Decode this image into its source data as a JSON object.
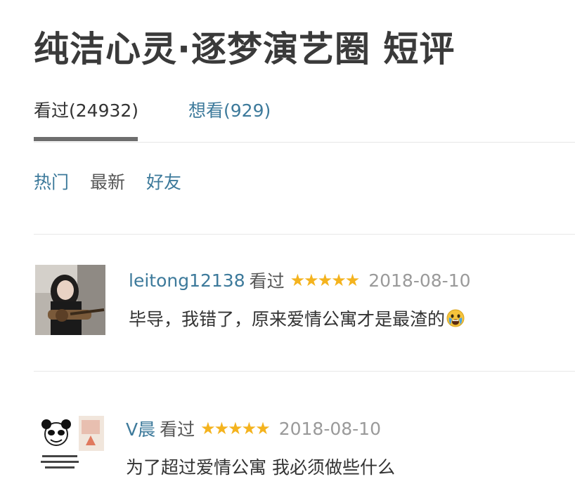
{
  "page": {
    "title": "纯洁心灵·逐梦演艺圈 短评"
  },
  "tabs": [
    {
      "label": "看过(24932)",
      "active": true
    },
    {
      "label": "想看(929)",
      "active": false
    }
  ],
  "filters": [
    {
      "label": "热门"
    },
    {
      "label": "最新"
    },
    {
      "label": "好友"
    }
  ],
  "comments": [
    {
      "username": "leitong12138",
      "status": "看过",
      "rating_stars": 5,
      "date": "2018-08-10",
      "text": "毕导，我错了，原来爱情公寓才是最渣的",
      "emoji": "crying-face-icon"
    },
    {
      "username": "V晨",
      "status": "看过",
      "rating_stars": 5,
      "date": "2018-08-10",
      "text": "为了超过爱情公寓 我必须做些什么"
    }
  ],
  "colors": {
    "link": "#3d7a9b",
    "star": "#f4b31e",
    "date": "#9a9a9a",
    "title": "#3a3a3a"
  }
}
